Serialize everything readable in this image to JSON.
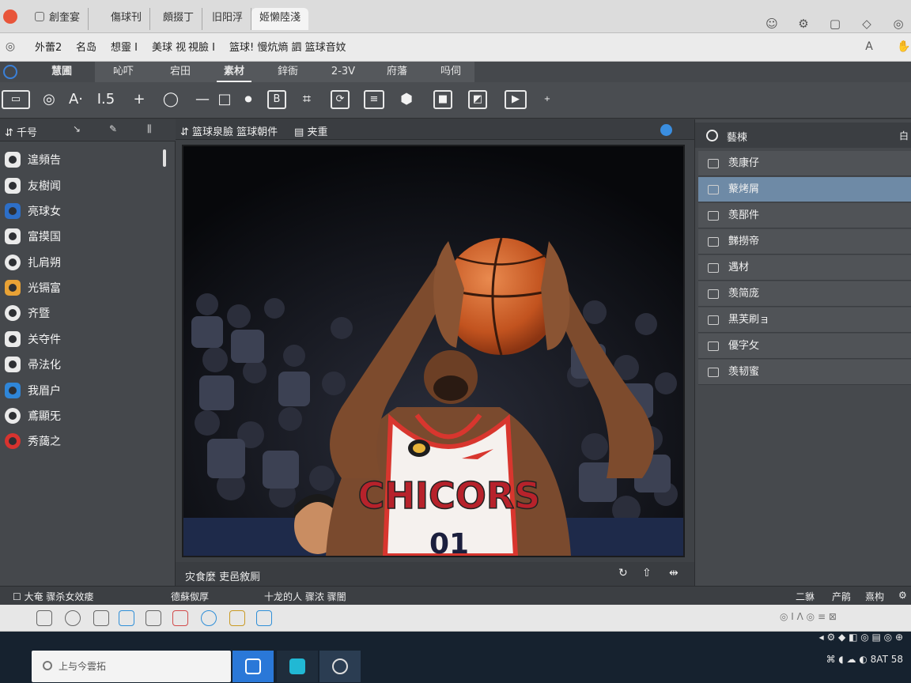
{
  "browser": {
    "tabs": [
      {
        "label": "創奎宴"
      },
      {
        "label": "傷球刊"
      },
      {
        "label": "頗掇丁"
      },
      {
        "label": "旧阳浮"
      },
      {
        "label": "姬懒陸淺"
      }
    ]
  },
  "menubar": {
    "items": [
      "外蕾2",
      "名岛",
      "想靈 I",
      "美球 视",
      "視臉 I",
      "篮球! 慢炕熵 訵 篮球音妏"
    ]
  },
  "apptabs": {
    "items": [
      "慧圃",
      "吣吓",
      "宕田",
      "素材",
      "鋅衙",
      "2-3V",
      "府藩",
      "吗伺"
    ],
    "active_index": 3
  },
  "toolbar": {
    "text_tool": "A·",
    "size_tool": "ꓲ.5",
    "plus": "+",
    "minus": "—",
    "bold": "B"
  },
  "left_panel": {
    "title": "千号",
    "items": [
      "遑頻告",
      "友樹闻",
      "亮球女",
      "富摸国",
      "扎肩朔",
      "光镉富",
      "齐暨",
      "关夺件",
      "帚法化",
      "我眉户",
      "鳶顯旡",
      "秀藹之"
    ]
  },
  "center": {
    "header_title": "篮球泉臉 篮球朝件",
    "header_sub": "夹重",
    "footer_text": "灾食麼  吏邑敘厠",
    "photo": {
      "jersey_text": "CHICORS",
      "jersey_number": "01"
    }
  },
  "right_panel": {
    "title": "藝楝",
    "corner": "白",
    "items": [
      "羡康仔",
      "藂烤屑",
      "羡郚件",
      "豑撈帝",
      "遇材",
      "羡简庞",
      "黑芙刷ョ",
      "優字攵",
      "羡韧蜜"
    ],
    "selected_index": 1
  },
  "status": {
    "left": "大奄  骤杀女效瘘",
    "mid": "德蘇伮厚",
    "mid2": "十龙的人 骤浓 骤闇",
    "right": [
      "二貅",
      "产鹃",
      "熹构"
    ]
  },
  "taskbar": {
    "search_placeholder": "上与今雲拓",
    "tray_time": "8AT 58"
  }
}
